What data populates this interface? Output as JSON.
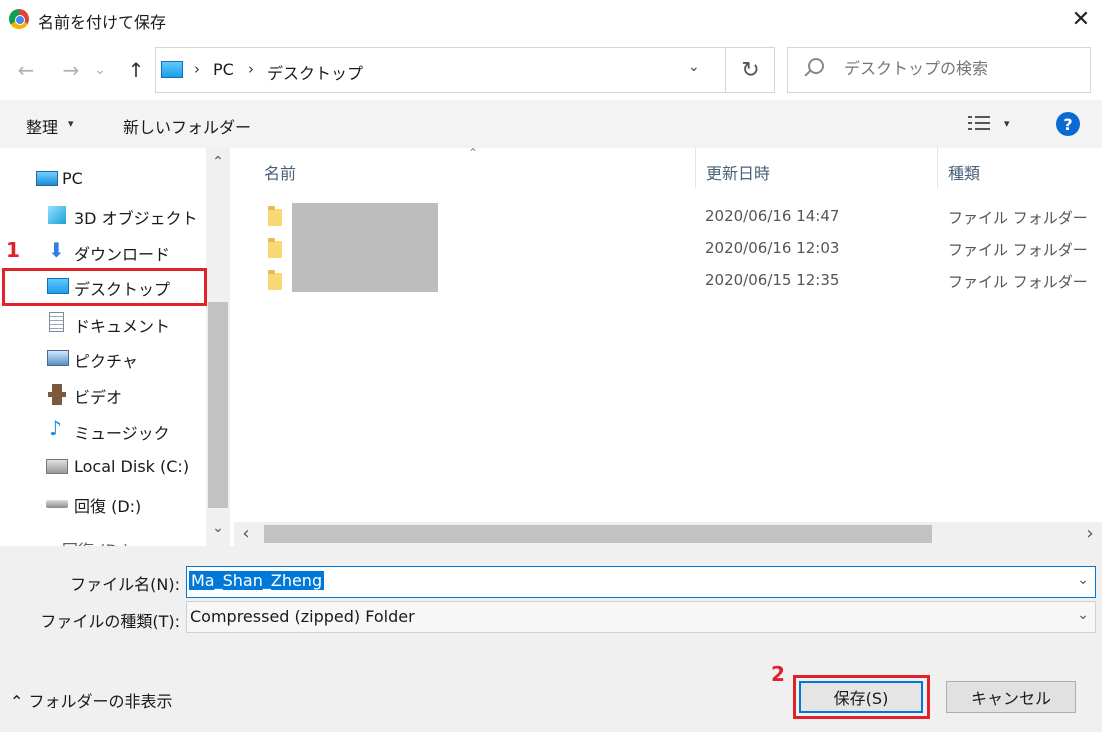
{
  "titlebar": {
    "title": "名前を付けて保存",
    "close": "✕"
  },
  "nav_buttons": {
    "back": "←",
    "forward": "→",
    "recent": "⌄",
    "up": "↑"
  },
  "address": {
    "crumbs": [
      "PC",
      "デスクトップ"
    ],
    "separator": "›",
    "dropdown": "⌄",
    "refresh": "↻"
  },
  "search": {
    "placeholder": "デスクトップの検索"
  },
  "commands": {
    "organize": "整理",
    "organize_caret": "▾",
    "new_folder": "新しいフォルダー",
    "view_caret": "▾",
    "help": "?"
  },
  "nav_pane": {
    "items": [
      {
        "label": "PC",
        "icon": "pc-icon"
      },
      {
        "label": "3D オブジェクト",
        "icon": "3d-objects-icon"
      },
      {
        "label": "ダウンロード",
        "icon": "download-icon"
      },
      {
        "label": "デスクトップ",
        "icon": "desktop-icon",
        "selected": true
      },
      {
        "label": "ドキュメント",
        "icon": "document-icon"
      },
      {
        "label": "ピクチャ",
        "icon": "pictures-icon"
      },
      {
        "label": "ビデオ",
        "icon": "video-icon"
      },
      {
        "label": "ミュージック",
        "icon": "music-icon"
      },
      {
        "label": "Local Disk (C:)",
        "icon": "local-disk-icon"
      },
      {
        "label": "回復 (D:)",
        "icon": "recovery-drive-icon"
      },
      {
        "label": "回復 (D:)",
        "icon": "recovery-drive-icon"
      }
    ],
    "scroll_up": "⌃",
    "scroll_down": "⌄"
  },
  "file_list": {
    "columns": {
      "name": "名前",
      "date": "更新日時",
      "type": "種類"
    },
    "sort_caret": "⌃",
    "rows": [
      {
        "date": "2020/06/16 14:47",
        "type": "ファイル フォルダー"
      },
      {
        "date": "2020/06/16 12:03",
        "type": "ファイル フォルダー"
      },
      {
        "date": "2020/06/15 12:35",
        "type": "ファイル フォルダー"
      }
    ],
    "scroll_left": "‹",
    "scroll_right": "›"
  },
  "form": {
    "filename_label": "ファイル名(N):",
    "filename_value": "Ma_Shan_Zheng",
    "filetype_label": "ファイルの種類(T):",
    "filetype_value": "Compressed (zipped) Folder",
    "caret": "⌄"
  },
  "footer": {
    "hide_folders_caret": "⌃",
    "hide_folders": "フォルダーの非表示",
    "save": "保存(S)",
    "cancel": "キャンセル"
  },
  "annotations": {
    "step1": "1",
    "step2": "2"
  },
  "colors": {
    "accent": "#0078d7",
    "highlight": "#e0232a",
    "folder": "#f8d775"
  }
}
